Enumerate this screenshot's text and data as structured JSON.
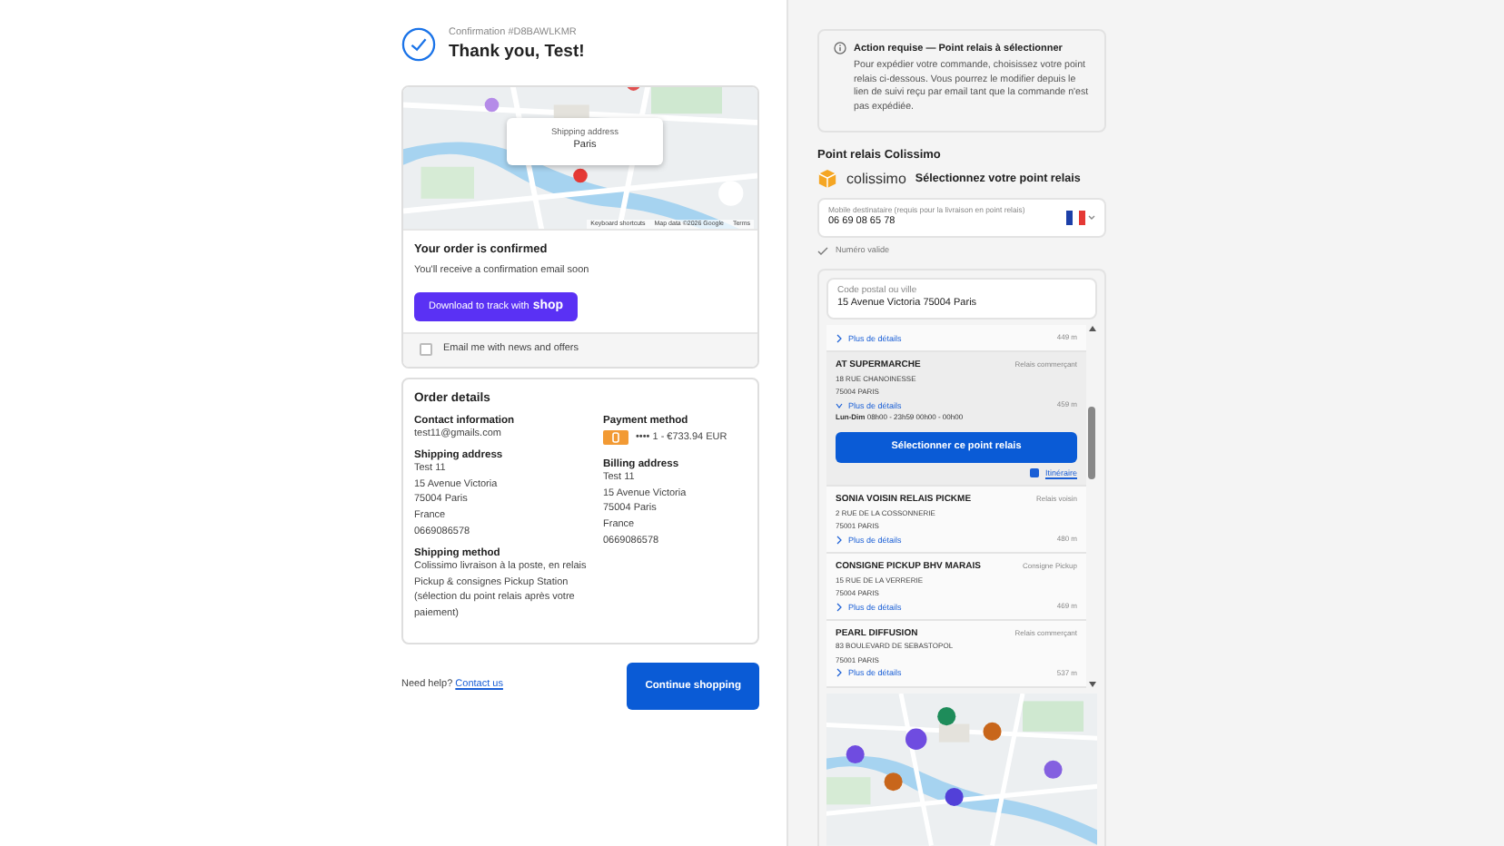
{
  "header": {
    "confirmation": "Confirmation #D8BAWLKMR",
    "title": "Thank you, Test!"
  },
  "map": {
    "overlay_label": "Shipping address",
    "overlay_city": "Paris",
    "attribution": [
      "Keyboard shortcuts",
      "Map data ©2026 Google",
      "Terms"
    ]
  },
  "confirmed": {
    "title": "Your order is confirmed",
    "text": "You'll receive a confirmation email soon",
    "button": "Download to track with",
    "button_brand": "shop"
  },
  "newsletter": {
    "label": "Email me with news and offers",
    "checked": false
  },
  "details": {
    "title": "Order details",
    "left": [
      {
        "heading": "Contact information",
        "lines": [
          "test11@gmails.com"
        ]
      },
      {
        "heading": "Shipping address",
        "lines": [
          "Test 11",
          "15 Avenue Victoria",
          "75004 Paris",
          "France",
          "0669086578"
        ]
      },
      {
        "heading": "Shipping method",
        "lines": [
          "Colissimo livraison à la poste, en relais Pickup & consignes Pickup Station (sélection du point relais après votre paiement)"
        ]
      }
    ],
    "payment": {
      "heading": "Payment method",
      "text": "•••• 1 - €733.94 EUR"
    },
    "billing": {
      "heading": "Billing address",
      "lines": [
        "Test 11",
        "15 Avenue Victoria",
        "75004 Paris",
        "France",
        "0669086578"
      ]
    }
  },
  "help": {
    "text": "Need help?",
    "link": "Contact us"
  },
  "continue_button": "Continue shopping",
  "notice": {
    "title": "Action requise — Point relais à sélectionner",
    "text": "Pour expédier votre commande, choisissez votre point relais ci-dessous. Vous pourrez le modifier depuis le lien de suivi reçu par email tant que la commande n'est pas expédiée."
  },
  "relay": {
    "section_title": "Point relais Colissimo",
    "brand": "colissimo",
    "heading": "Sélectionnez votre point relais",
    "phone": {
      "label": "Mobile destinataire (requis pour la livraison en point relais)",
      "value": "06 69 08 65 78",
      "validation": "Numéro valide"
    },
    "search": {
      "label": "Code postal ou ville",
      "value": "15 Avenue Victoria 75004 Paris"
    },
    "points": [
      {
        "kind": "partial",
        "details": "Plus de détails",
        "distance": "449 m",
        "selected": false,
        "expanded": false
      },
      {
        "kind": "full",
        "name": "AT SUPERMARCHE",
        "type": "Relais commerçant",
        "address": [
          "18 RUE CHANOINESSE",
          "75004 PARIS"
        ],
        "details": "Plus de détails",
        "distance": "459 m",
        "selected": true,
        "expanded": true,
        "hours_day": "Lun-Dim",
        "hours": "08h00 - 23h59 00h00 - 00h00",
        "select_button": "Sélectionner ce point relais",
        "route_link": "Itinéraire"
      },
      {
        "kind": "full",
        "name": "SONIA VOISIN RELAIS PICKME",
        "type": "Relais voisin",
        "address": [
          "2 RUE DE LA COSSONNERIE",
          "75001 PARIS"
        ],
        "details": "Plus de détails",
        "distance": "480 m",
        "selected": false,
        "expanded": false
      },
      {
        "kind": "full",
        "name": "CONSIGNE PICKUP BHV MARAIS",
        "type": "Consigne Pickup",
        "address": [
          "15 RUE DE LA VERRERIE",
          "75004 PARIS"
        ],
        "details": "Plus de détails",
        "distance": "469 m",
        "selected": false,
        "expanded": false
      },
      {
        "kind": "full",
        "name": "PEARL DIFFUSION",
        "type": "Relais commerçant",
        "address": [
          "83 BOULEVARD DE SEBASTOPOL",
          "75001 PARIS"
        ],
        "details": "Plus de détails",
        "distance": "537 m",
        "selected": false,
        "expanded": false
      }
    ]
  }
}
